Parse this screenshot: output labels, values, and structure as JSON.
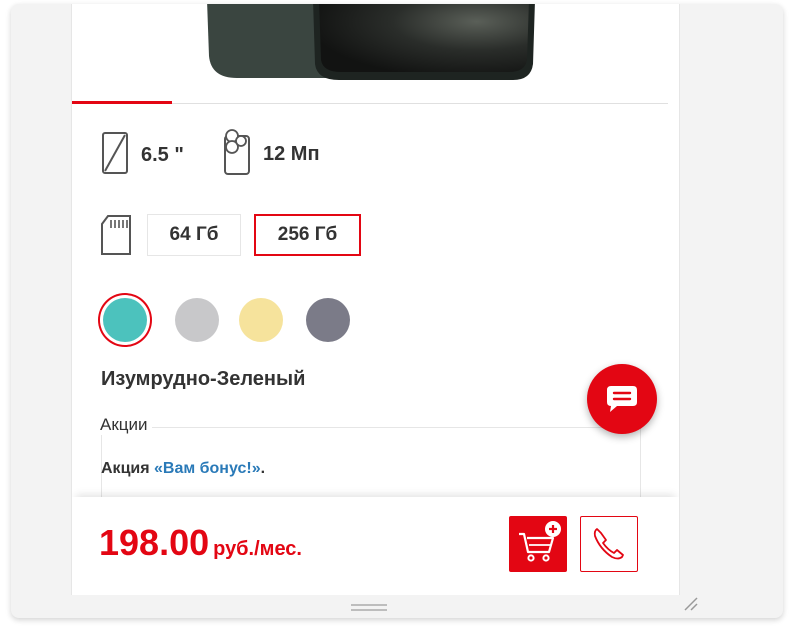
{
  "product": {
    "screen_size": "6.5 \"",
    "camera": "12 Мп",
    "storage_options": [
      "64 Гб",
      "256 Гб"
    ],
    "selected_storage": "256 Гб",
    "colors": [
      "#4cc2bd",
      "#c8c8ca",
      "#f6e39c",
      "#7b7b88"
    ],
    "selected_color_name": "Изумрудно-Зеленый"
  },
  "promo": {
    "title": "Акции",
    "prefix": "Акция ",
    "link_text": "«Вам бонус!»",
    "suffix": "."
  },
  "footer": {
    "price_amount": "198.00",
    "price_unit": "руб./мес."
  },
  "icons": {
    "screen": "screen-size-icon",
    "camera": "camera-icon",
    "storage": "sd-card-icon",
    "chat": "chat-icon",
    "cart": "add-to-cart-icon",
    "call": "phone-icon"
  },
  "accent_color": "#e30613"
}
